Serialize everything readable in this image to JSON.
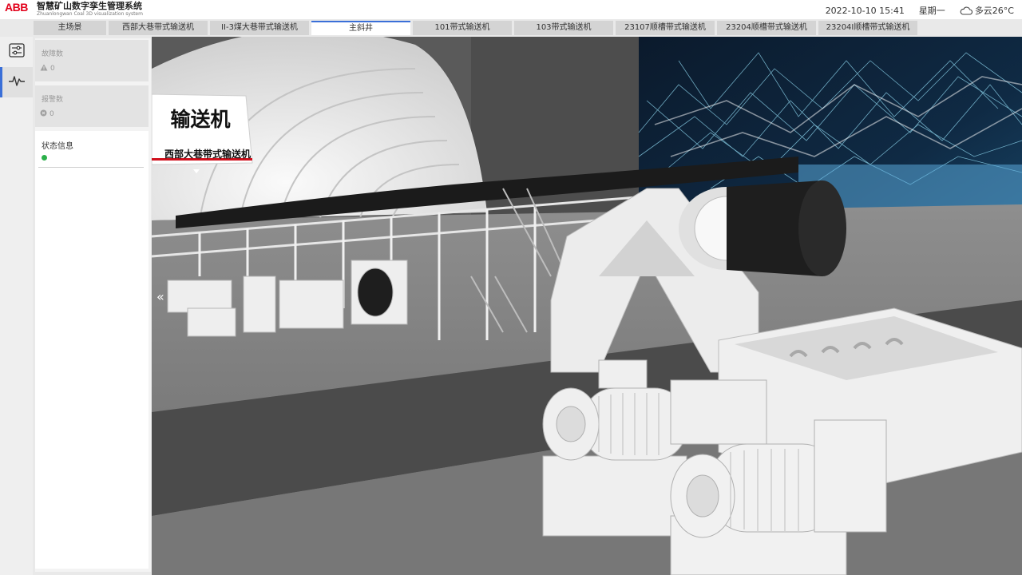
{
  "header": {
    "logo_text": "ABB",
    "title": "智慧矿山数字孪生管理系统",
    "subtitle": "Zhuanlongwan Coal 3D visualization system",
    "datetime": "2022-10-10 15:41",
    "weekday": "星期一",
    "weather": "多云26°C",
    "weather_icon": "cloud-icon"
  },
  "tabs": [
    {
      "label": "主场景"
    },
    {
      "label": "西部大巷带式输送机"
    },
    {
      "label": "II-3煤大巷带式输送机"
    },
    {
      "label": "主斜井",
      "active": true
    },
    {
      "label": "101带式输送机"
    },
    {
      "label": "103带式输送机"
    },
    {
      "label": "23107顺槽带式输送机"
    },
    {
      "label": "23204顺槽带式输送机"
    },
    {
      "label": "23204I顺槽带式输送机"
    }
  ],
  "rail": {
    "items": [
      {
        "icon": "sliders-icon"
      },
      {
        "icon": "pulse-icon",
        "active": true
      }
    ]
  },
  "panel": {
    "fault": {
      "label": "故障数",
      "value": "0",
      "icon": "warning-icon"
    },
    "alarm": {
      "label": "报警数",
      "value": "0",
      "icon": "close-circle-icon"
    },
    "status": {
      "label": "状态信息",
      "indicator_color": "#2bb04a"
    }
  },
  "scene": {
    "sign_title": "输送机",
    "sign_subtitle": "西部大巷带式输送机",
    "collapse_glyph": "«"
  },
  "colors": {
    "brand": "#e2001a",
    "accent": "#3a6fd8"
  }
}
